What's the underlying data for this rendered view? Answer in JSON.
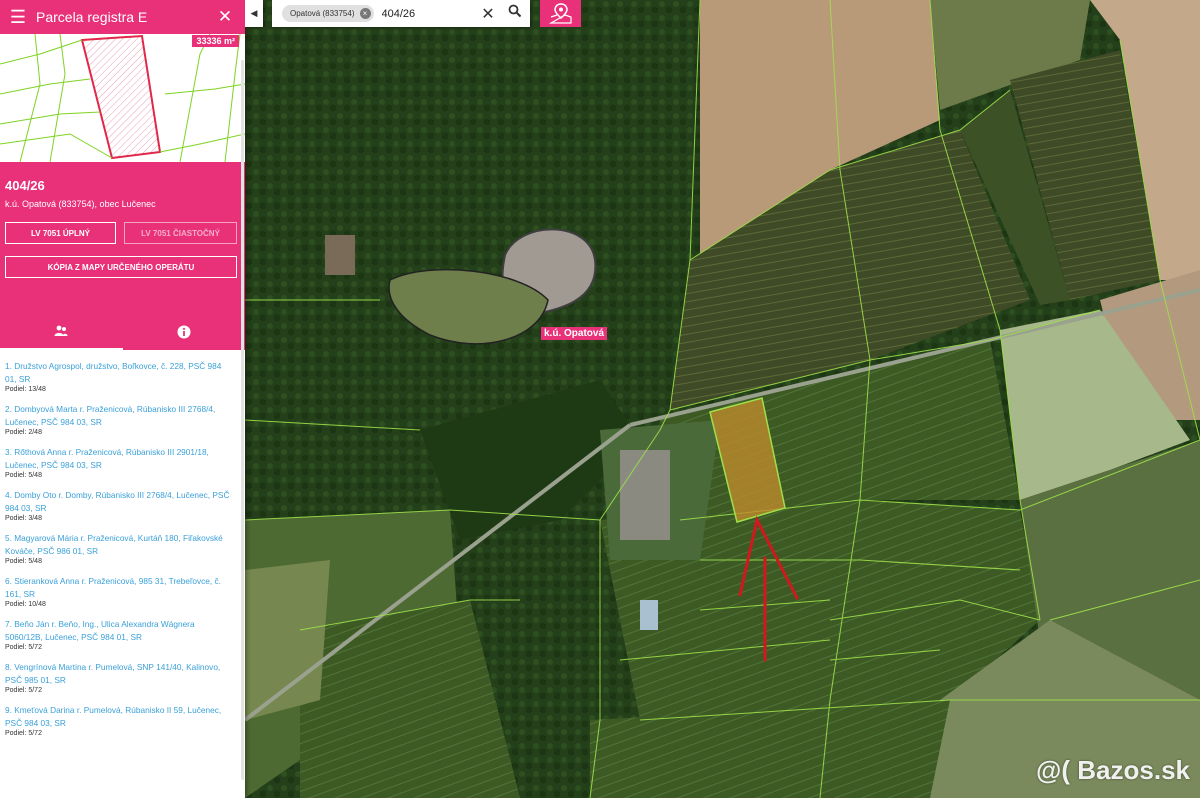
{
  "panel": {
    "title": "Parcela registra E",
    "area": "33336 m²",
    "parcel_number": "404/26",
    "location": "k.ú. Opatová (833754), obec Lučenec",
    "btn_lv_full": "LV 7051 ÚPLNÝ",
    "btn_lv_partial": "LV 7051 ČIASTOČNÝ",
    "btn_copy": "KÓPIA Z MAPY URČENÉHO OPERÁTU",
    "owners": [
      {
        "name": "1. Družstvo Agrospol, družstvo, Boľkovce, č. 228, PSČ 984 01, SR",
        "share": "Podiel: 13/48"
      },
      {
        "name": "2. Dombyová Marta r. Praženicová, Rúbanisko III 2768/4, Lučenec, PSČ 984 03, SR",
        "share": "Podiel: 2/48"
      },
      {
        "name": "3. Rőthová Anna r. Praženicová, Rúbanisko III 2901/18, Lučenec, PSČ 984 03, SR",
        "share": "Podiel: 5/48"
      },
      {
        "name": "4. Domby Oto r. Domby, Rúbanisko III 2768/4, Lučenec, PSČ 984 03, SR",
        "share": "Podiel: 3/48"
      },
      {
        "name": "5. Magyarová Mária r. Praženicová, Kurtáň 180, Fiľakovské Kováče, PSČ 986 01, SR",
        "share": "Podiel: 5/48"
      },
      {
        "name": "6. Stieranková Anna r. Praženicová, 985 31, Trebeľovce, č. 161, SR",
        "share": "Podiel: 10/48"
      },
      {
        "name": "7. Beňo Ján r. Beňo, Ing., Ulica Alexandra Wágnera 5060/12B, Lučenec, PSČ 984 01, SR",
        "share": "Podiel: 5/72"
      },
      {
        "name": "8. Vengrínová Martina r. Pumelová, SNP 141/40, Kalinovo, PSČ 985 01, SR",
        "share": "Podiel: 5/72"
      },
      {
        "name": "9. Kmeťová Darina r. Pumelová, Rúbanisko II 59, Lučenec, PSČ 984 03, SR",
        "share": "Podiel: 5/72"
      }
    ]
  },
  "search": {
    "chip_label": "Opatová (833754)",
    "query": "404/26"
  },
  "map": {
    "area_label": "k.ú. Opatová"
  },
  "watermark": "@( Bazos.sk",
  "colors": {
    "accent": "#e9317a",
    "parcel_highlight": "#c08a2c",
    "arrow": "#d0191e",
    "boundary": "#9fe04a"
  },
  "icons": {
    "menu": "menu-icon",
    "close": "close-icon",
    "owners_tab": "people-icon",
    "info_tab": "info-icon",
    "collapse": "chevron-left-icon",
    "search": "search-icon",
    "locate": "map-pin-icon"
  }
}
